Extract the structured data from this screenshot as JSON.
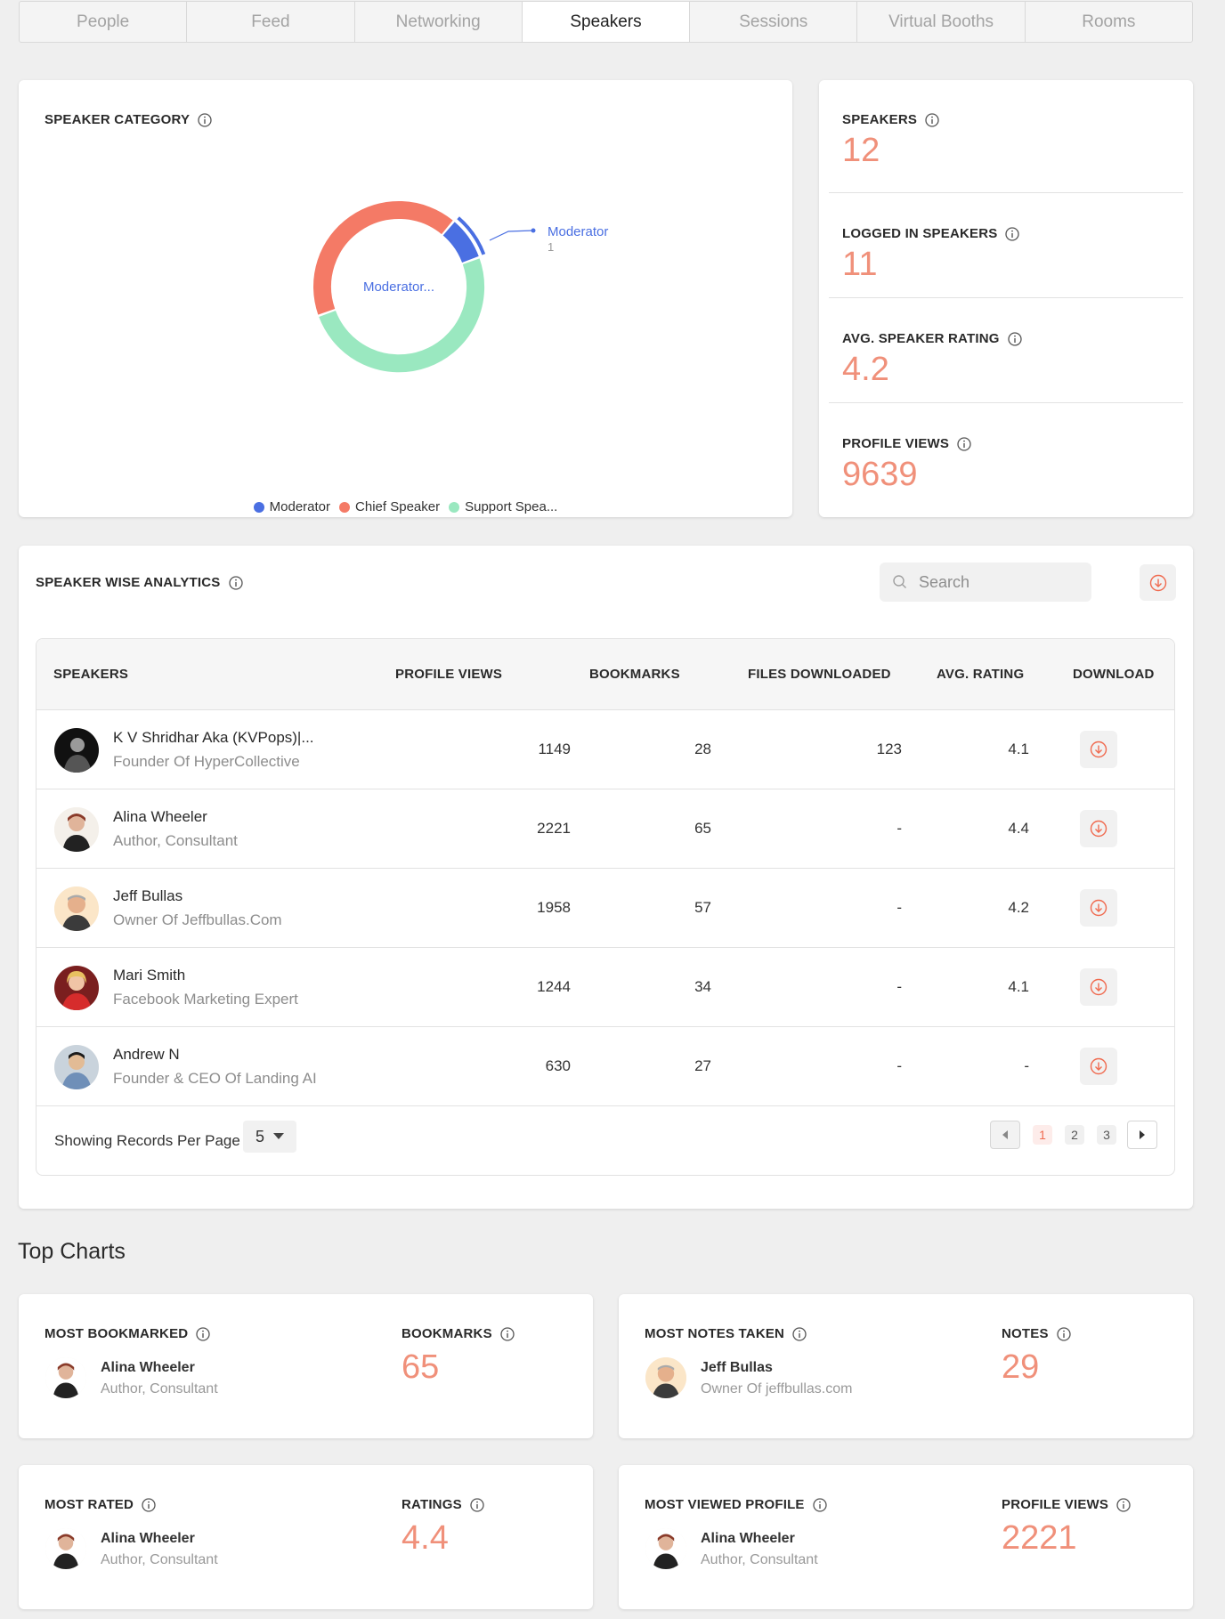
{
  "tabs": [
    "People",
    "Feed",
    "Networking",
    "Speakers",
    "Sessions",
    "Virtual Booths",
    "Rooms"
  ],
  "active_tab": "Speakers",
  "speaker_category": {
    "title": "SPEAKER CATEGORY",
    "center_label": "Moderator...",
    "callout_label": "Moderator",
    "callout_value": "1",
    "legend": [
      {
        "label": "Moderator",
        "color": "#4a6fe2"
      },
      {
        "label": "Chief Speaker",
        "color": "#f47a66"
      },
      {
        "label": "Support Spea...",
        "color": "#9ae8c0"
      }
    ]
  },
  "chart_data": {
    "type": "pie",
    "categories": [
      "Moderator",
      "Chief Speaker",
      "Support Speaker"
    ],
    "values": [
      1,
      5,
      6
    ],
    "colors": [
      "#4a6fe2",
      "#f47a66",
      "#9ae8c0"
    ]
  },
  "stats": [
    {
      "label": "SPEAKERS",
      "value": "12"
    },
    {
      "label": "LOGGED IN SPEAKERS",
      "value": "11"
    },
    {
      "label": "AVG. SPEAKER RATING",
      "value": "4.2"
    },
    {
      "label": "PROFILE VIEWS",
      "value": "9639"
    }
  ],
  "speaker_analytics": {
    "title": "SPEAKER WISE ANALYTICS",
    "search_placeholder": "Search",
    "columns": [
      "SPEAKERS",
      "PROFILE VIEWS",
      "BOOKMARKS",
      "FILES DOWNLOADED",
      "AVG. RATING",
      "DOWNLOAD"
    ],
    "rows": [
      {
        "name": "K V Shridhar Aka (KVPops)|...",
        "role": "Founder Of HyperCollective",
        "profile_views": "1149",
        "bookmarks": "28",
        "files_downloaded": "123",
        "avg_rating": "4.1"
      },
      {
        "name": "Alina Wheeler",
        "role": "Author, Consultant",
        "profile_views": "2221",
        "bookmarks": "65",
        "files_downloaded": "-",
        "avg_rating": "4.4"
      },
      {
        "name": "Jeff Bullas",
        "role": "Owner Of Jeffbullas.Com",
        "profile_views": "1958",
        "bookmarks": "57",
        "files_downloaded": "-",
        "avg_rating": "4.2"
      },
      {
        "name": "Mari Smith",
        "role": "Facebook Marketing Expert",
        "profile_views": "1244",
        "bookmarks": "34",
        "files_downloaded": "-",
        "avg_rating": "4.1"
      },
      {
        "name": "Andrew N",
        "role": "Founder & CEO Of Landing AI",
        "profile_views": "630",
        "bookmarks": "27",
        "files_downloaded": "-",
        "avg_rating": "-"
      }
    ],
    "footer": {
      "records_label": "Showing Records Per Page",
      "records_value": "5",
      "pages": [
        "1",
        "2",
        "3"
      ],
      "active_page": "1"
    }
  },
  "top_charts": {
    "title": "Top Charts",
    "cards": [
      {
        "title": "MOST BOOKMARKED",
        "metric_label": "BOOKMARKS",
        "metric_value": "65",
        "name": "Alina Wheeler",
        "role": "Author, Consultant"
      },
      {
        "title": "MOST NOTES TAKEN",
        "metric_label": "NOTES",
        "metric_value": "29",
        "name": "Jeff Bullas",
        "role": "Owner Of jeffbullas.com"
      },
      {
        "title": "MOST RATED",
        "metric_label": "RATINGS",
        "metric_value": "4.4",
        "name": "Alina Wheeler",
        "role": "Author, Consultant"
      },
      {
        "title": "MOST VIEWED PROFILE",
        "metric_label": "PROFILE VIEWS",
        "metric_value": "2221",
        "name": "Alina Wheeler",
        "role": "Author, Consultant"
      }
    ]
  }
}
